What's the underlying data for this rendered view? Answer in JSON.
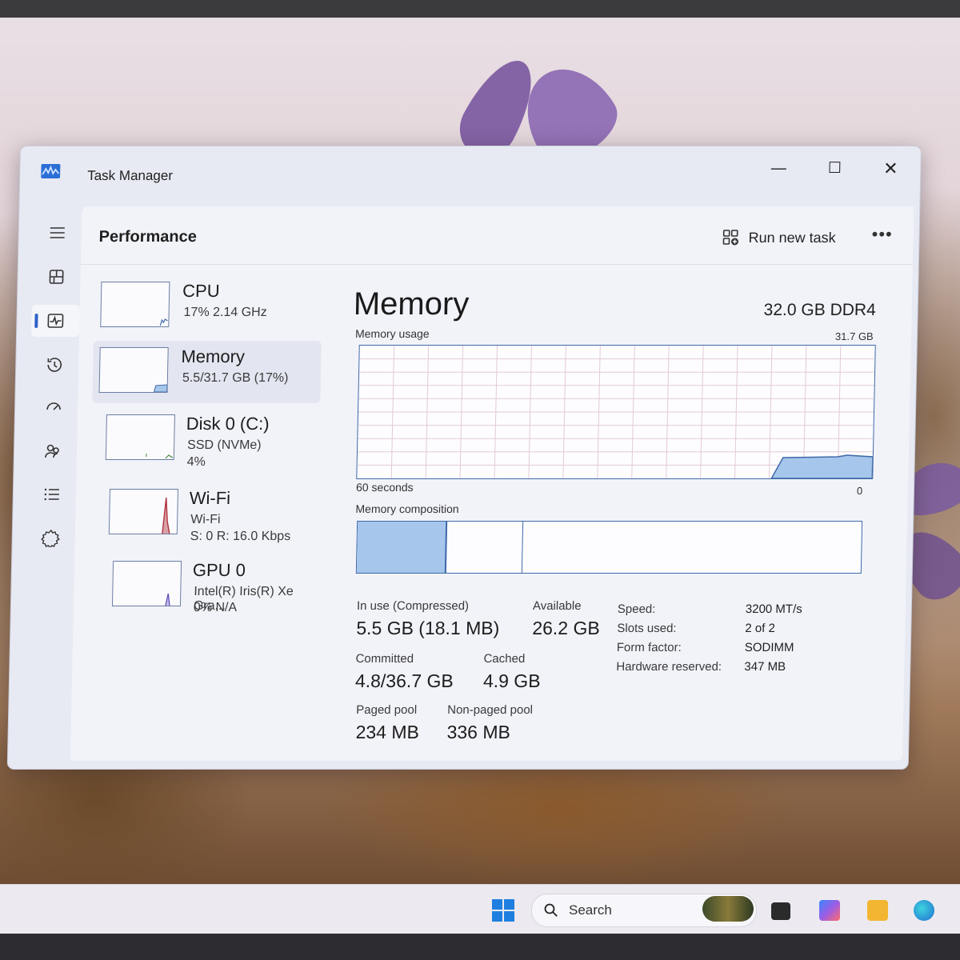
{
  "window": {
    "title": "Task Manager",
    "controls": {
      "minimize": "—",
      "maximize": "☐",
      "close": "✕"
    }
  },
  "header": {
    "title": "Performance",
    "run_new_task": "Run new task",
    "more": "•••"
  },
  "nav": {
    "items": [
      {
        "icon": "menu-icon"
      },
      {
        "icon": "processes-icon"
      },
      {
        "icon": "performance-icon",
        "active": true
      },
      {
        "icon": "app-history-icon"
      },
      {
        "icon": "startup-apps-icon"
      },
      {
        "icon": "users-icon"
      },
      {
        "icon": "details-icon"
      },
      {
        "icon": "services-icon"
      }
    ],
    "settings_icon": "settings-icon"
  },
  "devices": [
    {
      "name": "CPU",
      "line1": "17%  2.14 GHz",
      "line2": ""
    },
    {
      "name": "Memory",
      "line1": "5.5/31.7 GB (17%)",
      "line2": "",
      "selected": true
    },
    {
      "name": "Disk 0 (C:)",
      "line1": "SSD (NVMe)",
      "line2": "4%"
    },
    {
      "name": "Wi-Fi",
      "line1": "Wi-Fi",
      "line2": "S: 0  R: 16.0 Kbps"
    },
    {
      "name": "GPU 0",
      "line1": "Intel(R) Iris(R) Xe Gra...",
      "line2": "0%  N/A"
    }
  ],
  "memory": {
    "title": "Memory",
    "type": "32.0 GB DDR4",
    "usage_label": "Memory usage",
    "usage_max": "31.7 GB",
    "time_label": "60 seconds",
    "time_zero": "0",
    "composition_label": "Memory composition",
    "stats": {
      "in_use_label": "In use (Compressed)",
      "in_use_value": "5.5 GB (18.1 MB)",
      "available_label": "Available",
      "available_value": "26.2 GB",
      "committed_label": "Committed",
      "committed_value": "4.8/36.7 GB",
      "cached_label": "Cached",
      "cached_value": "4.9 GB",
      "paged_label": "Paged pool",
      "paged_value": "234 MB",
      "nonpaged_label": "Non-paged pool",
      "nonpaged_value": "336 MB"
    },
    "specs": [
      {
        "label": "Speed:",
        "value": "3200 MT/s"
      },
      {
        "label": "Slots used:",
        "value": "2 of 2"
      },
      {
        "label": "Form factor:",
        "value": "SODIMM"
      },
      {
        "label": "Hardware reserved:",
        "value": "347 MB"
      }
    ]
  },
  "taskbar": {
    "search_placeholder": "Search"
  },
  "colors": {
    "accent": "#2f63c9",
    "graph_fill": "#a6c6ec",
    "graph_line": "#3f69a8"
  }
}
